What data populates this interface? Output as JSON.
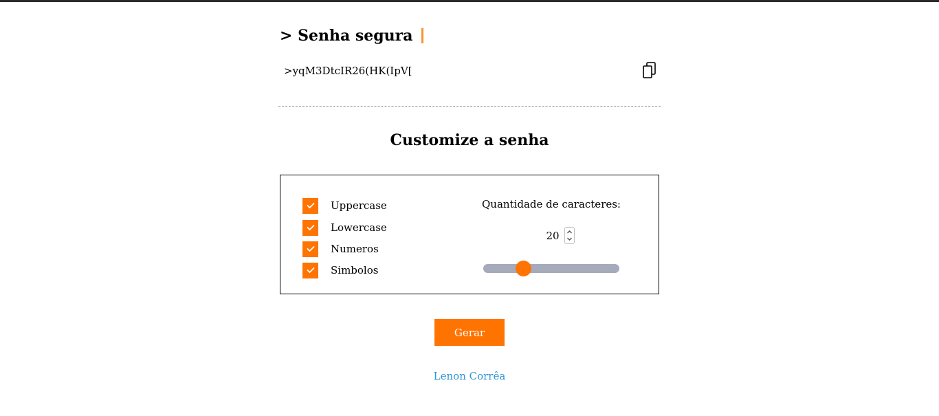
{
  "header": {
    "title": "> Senha segura",
    "cursor_color": "#f7922a"
  },
  "password": {
    "value": ">yqM3DtcIR26(HK(IpV[",
    "copy_icon": "copy-icon"
  },
  "customize": {
    "title": "Customize a senha",
    "options": [
      {
        "label": "Uppercase",
        "checked": true
      },
      {
        "label": "Lowercase",
        "checked": true
      },
      {
        "label": "Numeros",
        "checked": true
      },
      {
        "label": "Simbolos",
        "checked": true
      }
    ],
    "quantity_label": "Quantidade de caracteres:",
    "quantity_value": "20",
    "slider": {
      "value": 20,
      "min": 4,
      "max": 64
    }
  },
  "actions": {
    "generate_label": "Gerar"
  },
  "footer": {
    "author": "Lenon Corrêa"
  },
  "colors": {
    "accent": "#ff7300",
    "link": "#2f95d6",
    "slider_track": "#a5abbb"
  }
}
